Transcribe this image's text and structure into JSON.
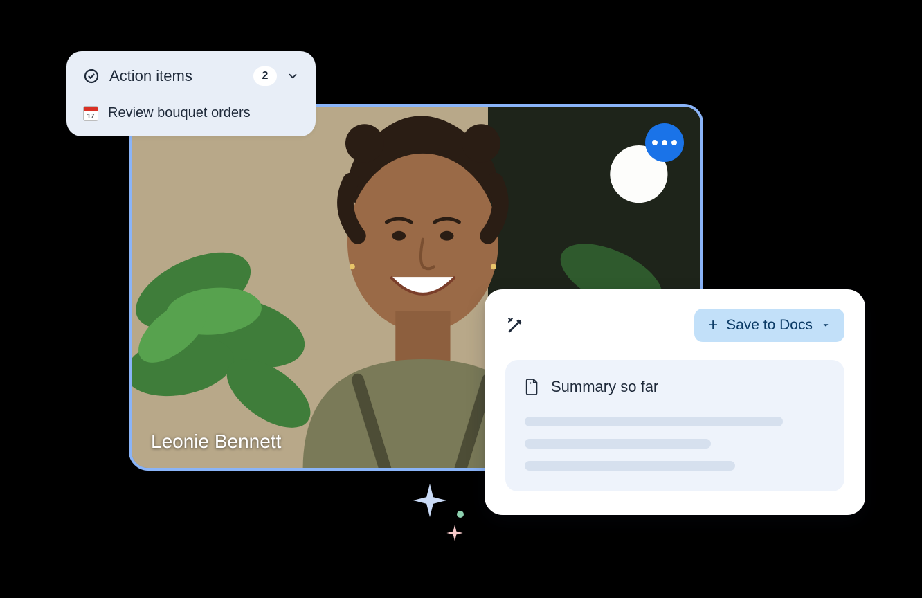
{
  "video": {
    "participant_name": "Leonie Bennett"
  },
  "action_items": {
    "title": "Action items",
    "count": "2",
    "items": [
      {
        "label": "Review bouquet orders",
        "calendar_day": "17"
      }
    ]
  },
  "summary": {
    "save_label": "Save to Docs",
    "section_title": "Summary so far"
  }
}
